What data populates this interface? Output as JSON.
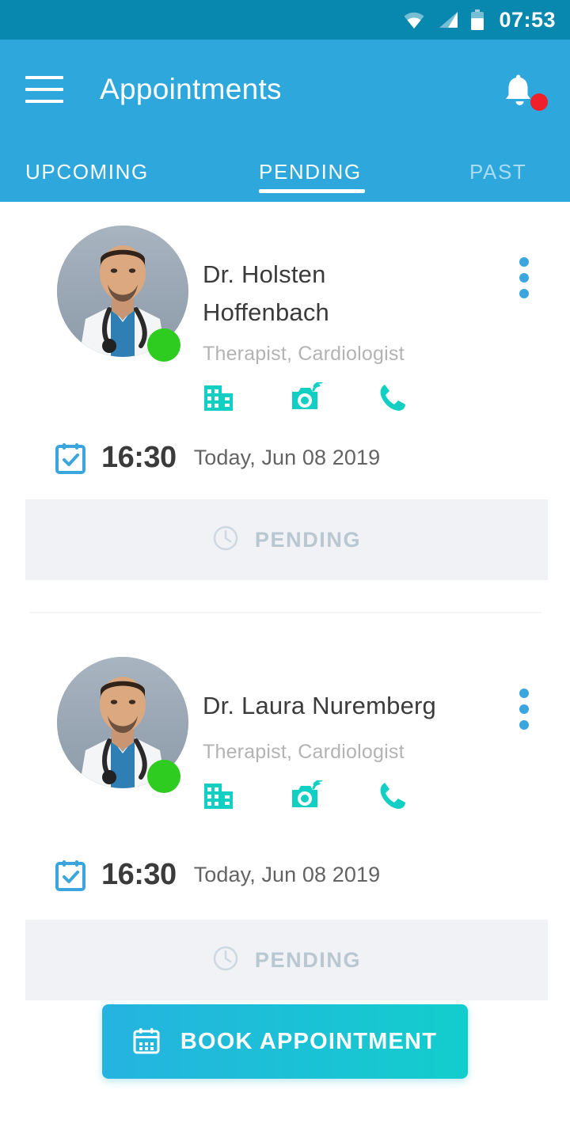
{
  "statusbar": {
    "time": "07:53",
    "icons": [
      "wifi-icon",
      "cellular-signal-icon",
      "battery-icon"
    ]
  },
  "appbar": {
    "menu_icon": "hamburger-menu-icon",
    "title": "Appointments",
    "notification_icon": "bell-icon",
    "notification_badge": true
  },
  "tabs": {
    "items": [
      {
        "label": "UPCOMING",
        "active": false
      },
      {
        "label": "PENDING",
        "active": true
      },
      {
        "label": "PAST",
        "active": false
      }
    ]
  },
  "appointments": [
    {
      "doctor_name_line1": "Dr. Holsten",
      "doctor_name_line2": "Hoffenbach",
      "specialty": "Therapist, Cardiologist",
      "online": true,
      "actions": [
        "hospital-icon",
        "video-camera-icon",
        "phone-icon"
      ],
      "menu_icon": "more-vertical-icon",
      "time": "16:30",
      "date": "Today, Jun 08 2019",
      "status": "PENDING",
      "status_icon": "clock-icon"
    },
    {
      "doctor_name_line1": "Dr. Laura Nuremberg",
      "doctor_name_line2": "",
      "specialty": "Therapist, Cardiologist",
      "online": true,
      "actions": [
        "hospital-icon",
        "video-camera-icon",
        "phone-icon"
      ],
      "menu_icon": "more-vertical-icon",
      "time": "16:30",
      "date": "Today, Jun 08 2019",
      "status": "PENDING",
      "status_icon": "clock-icon"
    }
  ],
  "cta": {
    "label": "BOOK APPOINTMENT",
    "icon": "calendar-icon"
  },
  "colors": {
    "statusbar_bg": "#0887af",
    "appbar_bg": "#2ea7dc",
    "accent_teal": "#13cdcd",
    "accent_blue": "#3ba6dd",
    "online_green": "#2ecc20",
    "badge_red": "#f0202a",
    "status_band_bg": "#f0f2f5",
    "status_text": "#b9c7d1"
  }
}
